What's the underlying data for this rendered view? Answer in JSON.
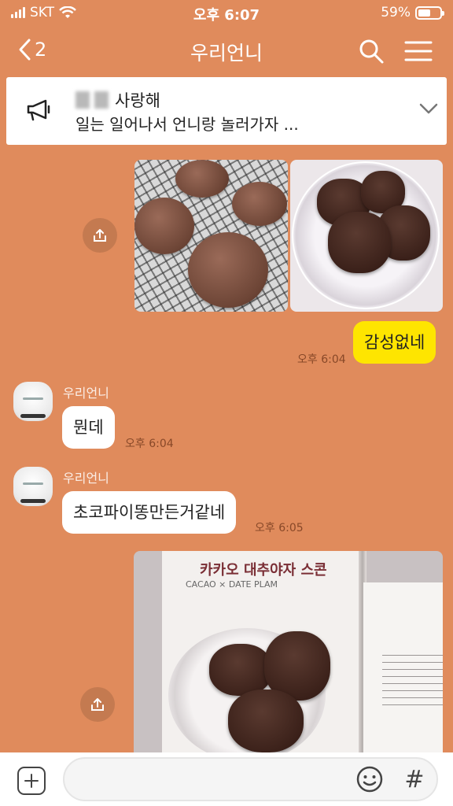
{
  "status_bar": {
    "carrier": "SKT",
    "time": "오후 6:07",
    "battery": "59%",
    "battery_level": 0.59
  },
  "nav": {
    "back_count": "2",
    "title": "우리언니",
    "icons": [
      "chevron-left-icon",
      "search-icon",
      "menu-icon"
    ]
  },
  "notice": {
    "sender": "사랑해",
    "text": "일는 일어나서 언니랑 놀러가자 ...",
    "icons": [
      "megaphone-icon",
      "chevron-down-icon"
    ]
  },
  "messages": [
    {
      "from": "me",
      "type": "photos",
      "photos": [
        "cookies on cooling rack",
        "cookies on glass plate"
      ]
    },
    {
      "from": "me",
      "type": "text",
      "text": "감성없네",
      "time": "오후 6:04"
    },
    {
      "from": "other",
      "sender": "우리언니",
      "type": "text",
      "text": "뭔데",
      "time": "오후 6:04"
    },
    {
      "from": "other",
      "sender": "우리언니",
      "type": "text",
      "text": "초코파이똥만든거같네",
      "time": "오후 6:05"
    },
    {
      "from": "me",
      "type": "photo",
      "photo": "cookbook page",
      "book_title": "카카오 대추야자 스콘",
      "book_subtitle": "CACAO × DATE PLAM"
    }
  ],
  "input": {
    "placeholder": "",
    "icons": [
      "plus-icon",
      "emoji-icon",
      "hashtag-icon"
    ],
    "hash": "#"
  },
  "colors": {
    "background": "#E08B5C",
    "my_bubble": "#FEE500",
    "other_bubble": "#FFFFFF"
  }
}
